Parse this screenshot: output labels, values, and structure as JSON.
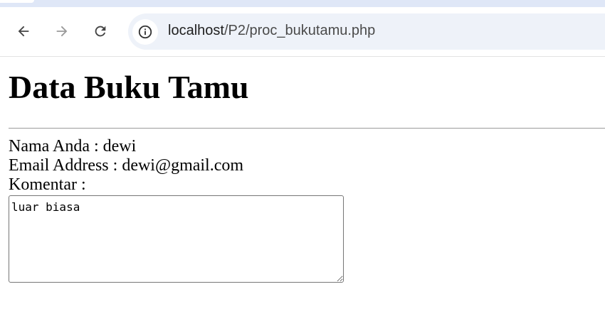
{
  "browser": {
    "url_host": "localhost",
    "url_path": "/P2/proc_bukutamu.php"
  },
  "page": {
    "title": "Data Buku Tamu",
    "name_line": "Nama Anda : dewi",
    "email_line": "Email Address : dewi@gmail.com",
    "comment_label": "Komentar :",
    "comment_value": "luar biasa"
  },
  "colors": {
    "tabstrip": "#dfe7f7",
    "omnibox": "#eef2f9",
    "text": "#000000"
  }
}
